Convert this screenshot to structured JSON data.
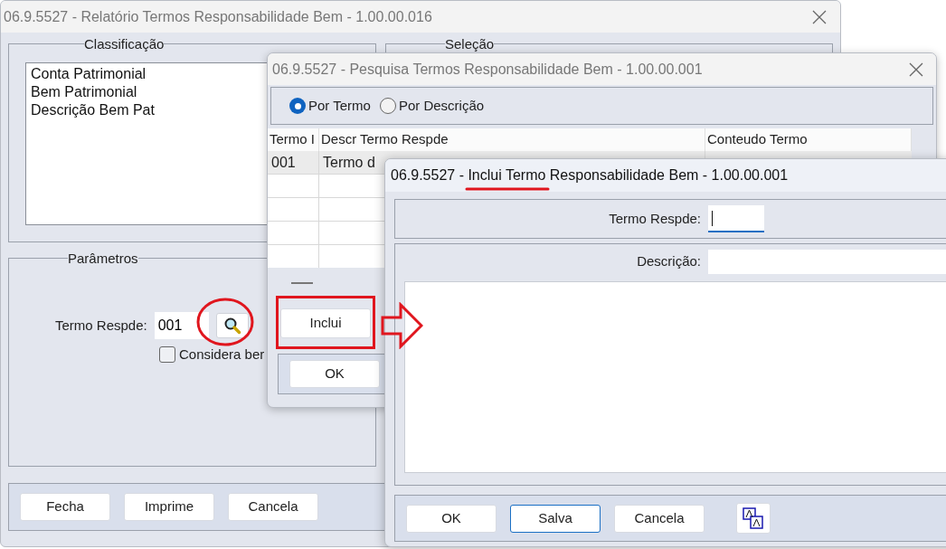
{
  "main_window": {
    "title": "06.9.5527 - Relatório Termos Responsabilidade Bem - 1.00.00.016",
    "classification": {
      "title": "Classificação",
      "items": [
        "Conta Patrimonial",
        "Bem Patrimonial",
        "Descrição Bem Pat"
      ]
    },
    "selection": {
      "title": "Seleção"
    },
    "parameters": {
      "title": "Parâmetros",
      "term_label": "Termo Respde:",
      "term_value": "001",
      "checkbox": {
        "label": "Considera ber",
        "checked": false
      }
    },
    "buttons": [
      "Fecha",
      "Imprime",
      "Cancela"
    ]
  },
  "search_window": {
    "title": "06.9.5527 - Pesquisa Termos Responsabilidade Bem - 1.00.00.001",
    "radios": [
      {
        "label": "Por Termo",
        "selected": true
      },
      {
        "label": "Por Descrição",
        "selected": false
      }
    ],
    "table": {
      "columns": [
        "Termo I",
        "Descr Termo Respde",
        "Conteudo Termo"
      ],
      "rows": [
        {
          "cells": [
            "001",
            "Termo d"
          ],
          "selected": true
        }
      ]
    },
    "include_button": "Inclui",
    "ok_button": "OK"
  },
  "include_window": {
    "title": "06.9.5527 - Inclui Termo Responsabilidade Bem - 1.00.00.001",
    "term_label": "Termo Respde:",
    "description_label": "Descrição:",
    "buttons": [
      {
        "label": "OK",
        "focused": false
      },
      {
        "label": "Salva",
        "focused": true
      },
      {
        "label": "Cancela",
        "focused": false
      }
    ]
  }
}
